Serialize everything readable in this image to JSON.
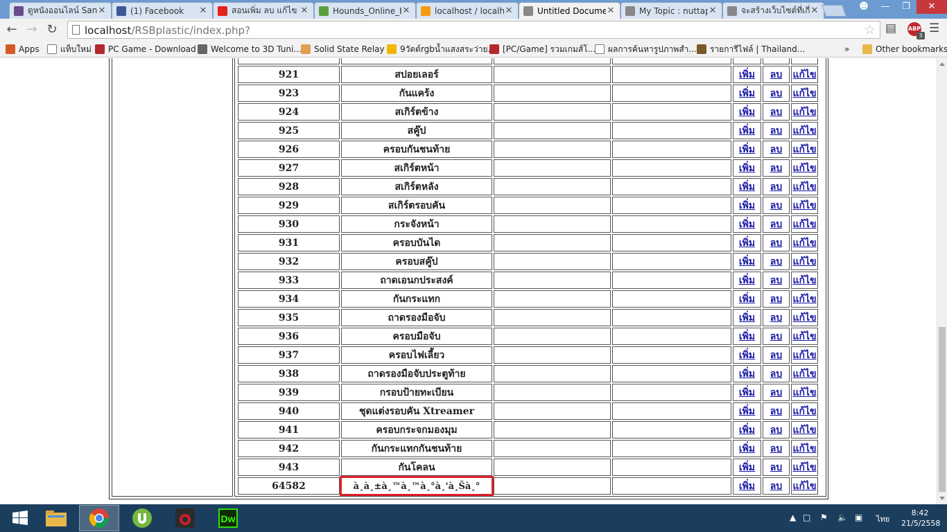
{
  "tabs": [
    {
      "title": "ดูหนังออนไลน์ Sanc",
      "icon": "film-icon",
      "color": "#6a4b8a"
    },
    {
      "title": "(1) Facebook",
      "icon": "facebook-icon",
      "color": "#3b5998"
    },
    {
      "title": "สอนเพิ่ม ลบ แก้ไข",
      "icon": "youtube-icon",
      "color": "#e62117"
    },
    {
      "title": "Hounds_Online_E",
      "icon": "download-icon",
      "color": "#5aa13c"
    },
    {
      "title": "localhost / localh",
      "icon": "phpmyadmin-icon",
      "color": "#f39c12"
    },
    {
      "title": "Untitled Docume",
      "icon": "page-icon",
      "color": "#888888"
    },
    {
      "title": "My Topic : nuttap",
      "icon": "page-icon",
      "color": "#888888"
    },
    {
      "title": "จะสร้างเว็บไซต์ที่เกี่ย",
      "icon": "page-icon",
      "color": "#888888"
    }
  ],
  "toolbar": {
    "url_host": "localhost",
    "url_path": "/RSBplastic/index.php?",
    "abp_label": "ABP",
    "abp_count": "3"
  },
  "bookmarks": {
    "items": [
      {
        "label": "Apps",
        "icon": "apps-icon"
      },
      {
        "label": "แท็บใหม่",
        "icon": "page-icon"
      },
      {
        "label": "PC Game - Download",
        "icon": "game-icon"
      },
      {
        "label": "Welcome to 3D Tuni...",
        "icon": "tuning-icon"
      },
      {
        "label": "Solid State Relay",
        "icon": "relay-icon"
      },
      {
        "label": "9วัตต์rgbน้ำแสงสระว่าย...",
        "icon": "light-icon"
      },
      {
        "label": "[PC/Game] รวมเกมส์โ...",
        "icon": "game-icon"
      },
      {
        "label": "ผลการค้นหารูปภาพสำ...",
        "icon": "page-icon"
      },
      {
        "label": "รายการีไฟล์ | Thailand...",
        "icon": "folder-icon"
      }
    ],
    "overflow": "»",
    "other": "Other bookmarks"
  },
  "actions": {
    "add": "เพิ่ม",
    "delete": "ลบ",
    "edit": "แก้ไข"
  },
  "rows": [
    {
      "id": "921",
      "name": "สปอยเลอร์"
    },
    {
      "id": "923",
      "name": "กันแคร้ง"
    },
    {
      "id": "924",
      "name": "สเกิร์ตข้าง"
    },
    {
      "id": "925",
      "name": "สคู๊ป"
    },
    {
      "id": "926",
      "name": "ครอบกันชนท้าย"
    },
    {
      "id": "927",
      "name": "สเกิร์ตหน้า"
    },
    {
      "id": "928",
      "name": "สเกิร์ตหลัง"
    },
    {
      "id": "929",
      "name": "สเกิร์ตรอบคัน"
    },
    {
      "id": "930",
      "name": "กระจังหน้า"
    },
    {
      "id": "931",
      "name": "ครอบบันได"
    },
    {
      "id": "932",
      "name": "ครอบสคู๊ป"
    },
    {
      "id": "933",
      "name": "ถาดเอนกประสงค์"
    },
    {
      "id": "934",
      "name": "กันกระแทก"
    },
    {
      "id": "935",
      "name": "ถาดรองมือจับ"
    },
    {
      "id": "936",
      "name": "ครอบมือจับ"
    },
    {
      "id": "937",
      "name": "ครอบไฟเลี้ยว"
    },
    {
      "id": "938",
      "name": "ถาดรองมือจับประตูท้าย"
    },
    {
      "id": "939",
      "name": "กรอบป้ายทะเบียน"
    },
    {
      "id": "940",
      "name": "ชุดแต่งรอบคัน Xtreamer"
    },
    {
      "id": "941",
      "name": "ครอบกระจกมองมุม"
    },
    {
      "id": "942",
      "name": "กันกระแทกกันชนท้าย"
    },
    {
      "id": "943",
      "name": "กันโคลน"
    },
    {
      "id": "64582",
      "name": "à¸à¸±à¸™à¸™à¸°à¸'à¸Šà¸°",
      "highlight": true
    }
  ],
  "clock": {
    "time": "8:42",
    "date": "21/5/2558",
    "lang": "ไทย"
  }
}
